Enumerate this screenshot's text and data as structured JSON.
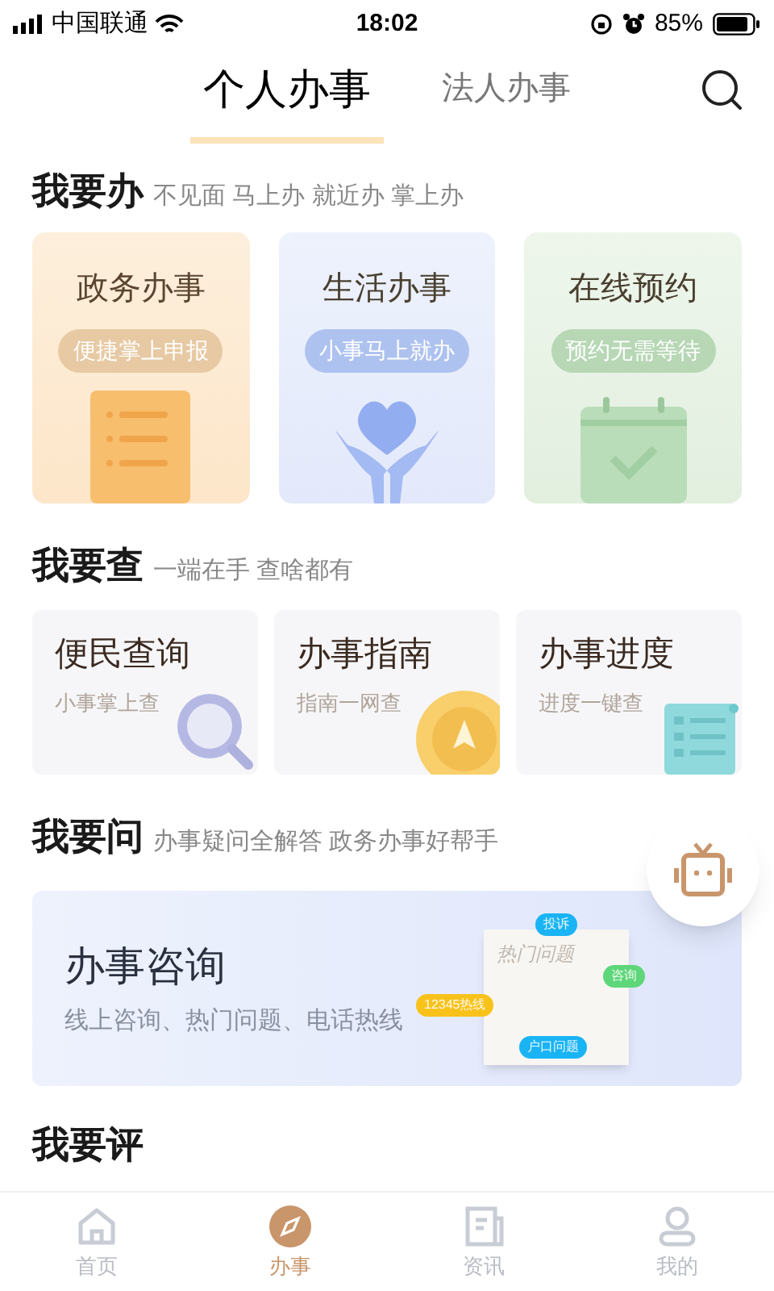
{
  "status_bar": {
    "carrier": "中国联通",
    "time": "18:02",
    "battery": "85%"
  },
  "tabs": [
    {
      "label": "个人办事",
      "selected": true
    },
    {
      "label": "法人办事",
      "selected": false
    }
  ],
  "sections": [
    {
      "title": "我要办",
      "subtitle": "不见面 马上办 就近办 掌上办",
      "kind": "big",
      "cards": [
        {
          "title": "政务办事",
          "badge": "便捷掌上申报",
          "kind": "document"
        },
        {
          "title": "生活办事",
          "badge": "小事马上就办",
          "kind": "heart"
        },
        {
          "title": "在线预约",
          "badge": "预约无需等待",
          "kind": "calendar"
        }
      ]
    },
    {
      "title": "我要查",
      "subtitle": "一端在手 查啥都有",
      "kind": "small",
      "cards": [
        {
          "title": "便民查询",
          "badge": "小事掌上查",
          "kind": "magnifier"
        },
        {
          "title": "办事指南",
          "badge": "指南一网查",
          "kind": "compass"
        },
        {
          "title": "办事进度",
          "badge": "进度一键查",
          "kind": "scroll"
        }
      ]
    },
    {
      "title": "我要问",
      "subtitle": "办事疑问全解答 政务办事好帮手",
      "kind": "banner",
      "banner": {
        "title": "办事咨询",
        "subtitle": "线上咨询、热门问题、电话热线",
        "paper_title": "热门问题",
        "bubbles": [
          {
            "text": "投诉",
            "color": "#1ab4f5"
          },
          {
            "text": "咨询",
            "color": "#5ed67a"
          },
          {
            "text": "12345热线",
            "color": "#f8c21a"
          },
          {
            "text": "户口问题",
            "color": "#1ab4f5"
          }
        ]
      }
    },
    {
      "title": "我要评",
      "kind": "cut"
    }
  ],
  "bottom_nav": [
    {
      "label": "首页",
      "selected": false
    },
    {
      "label": "办事",
      "selected": true
    },
    {
      "label": "资讯",
      "selected": false
    },
    {
      "label": "我的",
      "selected": false
    }
  ]
}
